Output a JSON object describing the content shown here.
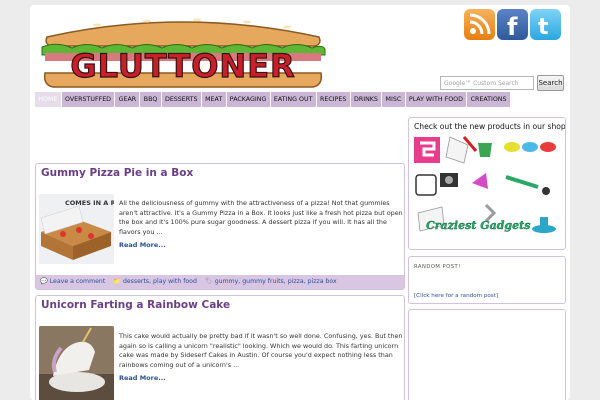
{
  "header": {
    "logo_text": "GLUTTONER",
    "social": [
      {
        "name": "rss"
      },
      {
        "name": "facebook"
      },
      {
        "name": "twitter"
      }
    ],
    "search": {
      "placeholder": "Google™ Custom Search",
      "button_label": "Search"
    }
  },
  "nav": {
    "items": [
      {
        "label": "HOME",
        "active": true
      },
      {
        "label": "OVERSTUFFED"
      },
      {
        "label": "GEAR"
      },
      {
        "label": "BBQ"
      },
      {
        "label": "DESSERTS"
      },
      {
        "label": "MEAT"
      },
      {
        "label": "PACKAGING"
      },
      {
        "label": "EATING OUT"
      },
      {
        "label": "RECIPES"
      },
      {
        "label": "DRINKS"
      },
      {
        "label": "MISC"
      },
      {
        "label": "PLAY WITH FOOD"
      },
      {
        "label": "CREATIONS"
      }
    ]
  },
  "posts": [
    {
      "title": "Gummy Pizza Pie in a Box",
      "thumb_text": "COMES IN A RE",
      "excerpt": "All the deliciousness of gummy with the attractiveness of a pizza! Not that gummies aren't attractive. It's a Gummy Pizza in a Box. It looks just like a fresh hot pizza but open the box and it's 100% pure sugar goodness. A dessert pizza if you will. It has all the flavors you ...",
      "more_label": "Read More...",
      "comment_label": "Leave a comment",
      "categories": "desserts, play with food",
      "tags": "gummy, gummy fruits, pizza, pizza box"
    },
    {
      "title": "Unicorn Farting a Rainbow Cake",
      "excerpt": "This cake would actually be pretty bad if it wasn't so well done. Confusing, yes. But then again so is calling a unicorn \"realistic\" looking. Which we would do. This farting unicorn cake was made by Sideserf Cakes in Austin. Of course you'd expect nothing less than rainbows coming out of a unicorn's ...",
      "more_label": "Read More..."
    }
  ],
  "sidebar": {
    "shop_title": "Check out the new products in our shop!",
    "shop_logo_text": "Craziest Gadgets",
    "random_title": "RANDOM POST!",
    "random_link": "[Click here for a random post]"
  },
  "colors": {
    "nav_bg": "#cbb6d6",
    "title_purple": "#6b3f86",
    "link_blue": "#2b4f9c",
    "meta_bg": "#d9c6e3"
  }
}
